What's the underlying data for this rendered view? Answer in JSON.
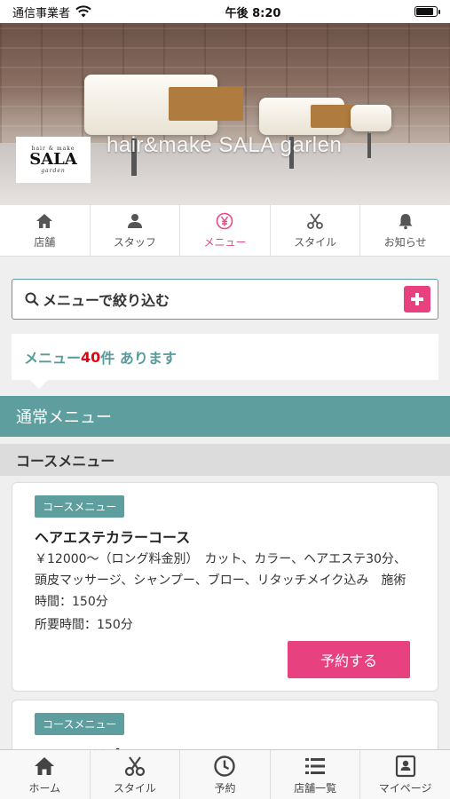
{
  "status_bar": {
    "carrier": "通信事業者",
    "time": "午後 8:20",
    "battery_level": 0.9
  },
  "hero": {
    "logo_small": "hair & make",
    "logo_main": "SALA",
    "logo_script": "garden",
    "title": "hair&make SALA garlen"
  },
  "tabs": [
    {
      "label": "店舗",
      "icon": "home-icon"
    },
    {
      "label": "スタッフ",
      "icon": "person-icon"
    },
    {
      "label": "メニュー",
      "icon": "yen-icon"
    },
    {
      "label": "スタイル",
      "icon": "scissors-icon"
    },
    {
      "label": "お知らせ",
      "icon": "bell-icon"
    }
  ],
  "active_tab": "メニュー",
  "search": {
    "label": "メニューで絞り込む"
  },
  "count": {
    "prefix": "メニュー",
    "number": "40",
    "suffix": "件 あります"
  },
  "section": {
    "title": "通常メニュー"
  },
  "subsection": {
    "title": "コースメニュー"
  },
  "cards": [
    {
      "tag": "コースメニュー",
      "title": "ヘアエステカラーコース",
      "description": "￥12000～（ロング料金別）　カット、カラー、ヘアエステ30分、頭皮マッサージ、シャンプー、ブロー、リタッチメイク込み　施術時間：150分",
      "duration": "所要時間：150分",
      "button": "予約する"
    },
    {
      "tag": "コースメニュー",
      "title": "ヘアエステパーマコース"
    }
  ],
  "bottom_nav": [
    {
      "label": "ホーム",
      "icon": "home-icon"
    },
    {
      "label": "スタイル",
      "icon": "scissors-icon"
    },
    {
      "label": "予約",
      "icon": "clock-icon"
    },
    {
      "label": "店舗一覧",
      "icon": "list-icon"
    },
    {
      "label": "マイページ",
      "icon": "id-card-icon"
    }
  ],
  "colors": {
    "accent": "#e8417f",
    "teal": "#5f9e9e",
    "highlight": "#e60012"
  }
}
